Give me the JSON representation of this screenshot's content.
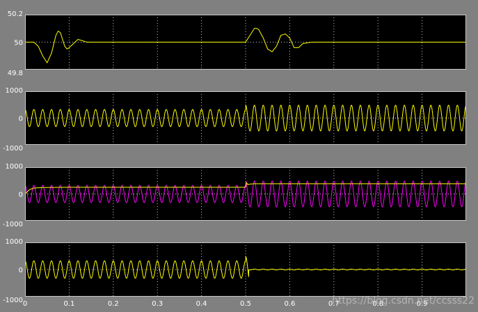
{
  "colors": {
    "figure_bg": "#808080",
    "plot_bg": "#000000",
    "grid": "#ffffff",
    "tick_text": "#ffffff",
    "yellow": "#ffff00",
    "magenta": "#ff00ff"
  },
  "watermark": "https://blog.csdn.net/ccsss22",
  "chart_data": [
    {
      "type": "line",
      "title": "",
      "xlabel": "",
      "ylabel": "",
      "xlim": [
        0,
        1
      ],
      "ylim": [
        49.8,
        50.2
      ],
      "xticks": [
        0,
        0.1,
        0.2,
        0.3,
        0.4,
        0.5,
        0.6,
        0.7,
        0.8,
        0.9
      ],
      "yticks": [
        {
          "value": 49.8,
          "label": "49.8"
        },
        {
          "value": 50,
          "label": "50"
        },
        {
          "value": 50.2,
          "label": "50.2"
        }
      ],
      "grid": true,
      "series": [
        {
          "color": "#ffff00",
          "kind": "points",
          "x": [
            0,
            0.01,
            0.02,
            0.03,
            0.04,
            0.05,
            0.06,
            0.07,
            0.075,
            0.08,
            0.09,
            0.095,
            0.1,
            0.11,
            0.12,
            0.13,
            0.14,
            0.15,
            0.2,
            0.3,
            0.4,
            0.5,
            0.51,
            0.52,
            0.525,
            0.53,
            0.54,
            0.55,
            0.56,
            0.57,
            0.58,
            0.59,
            0.6,
            0.61,
            0.62,
            0.63,
            0.65,
            0.7,
            0.8,
            0.9,
            1.0
          ],
          "y": [
            50,
            50,
            50,
            49.97,
            49.9,
            49.85,
            49.92,
            50.05,
            50.08,
            50.07,
            49.97,
            49.95,
            49.96,
            49.99,
            50.02,
            50.01,
            50,
            50,
            50,
            50,
            50,
            50,
            50.05,
            50.1,
            50.1,
            50.09,
            50.03,
            49.95,
            49.93,
            49.97,
            50.05,
            50.06,
            50.03,
            49.96,
            49.96,
            49.99,
            50,
            50,
            50,
            50,
            50
          ]
        }
      ]
    },
    {
      "type": "line",
      "title": "",
      "xlabel": "",
      "ylabel": "",
      "xlim": [
        0,
        1
      ],
      "ylim": [
        -1000,
        1000
      ],
      "xticks": [
        0,
        0.1,
        0.2,
        0.3,
        0.4,
        0.5,
        0.6,
        0.7,
        0.8,
        0.9
      ],
      "yticks": [
        {
          "value": -1000,
          "label": "-1000"
        },
        {
          "value": 0,
          "label": "0"
        },
        {
          "value": 1000,
          "label": "1000"
        }
      ],
      "grid": true,
      "series": [
        {
          "color": "#ffff00",
          "kind": "sine",
          "frequency_hz": 50,
          "segments": [
            {
              "t0": 0,
              "t1": 0.5,
              "amplitude": 320,
              "phase_deg": 90
            },
            {
              "t0": 0.5,
              "t1": 1.0,
              "amplitude": 480,
              "phase_deg": 90
            }
          ]
        }
      ]
    },
    {
      "type": "line",
      "title": "",
      "xlabel": "",
      "ylabel": "",
      "xlim": [
        0,
        1
      ],
      "ylim": [
        -1000,
        1000
      ],
      "xticks": [
        0,
        0.1,
        0.2,
        0.3,
        0.4,
        0.5,
        0.6,
        0.7,
        0.8,
        0.9
      ],
      "yticks": [
        {
          "value": -1000,
          "label": "-1000"
        },
        {
          "value": 0,
          "label": "0"
        },
        {
          "value": 1000,
          "label": "1000"
        }
      ],
      "grid": true,
      "series": [
        {
          "color": "#ff00ff",
          "kind": "sine",
          "frequency_hz": 50,
          "segments": [
            {
              "t0": 0,
              "t1": 0.5,
              "amplitude": 320,
              "phase_deg": 90
            },
            {
              "t0": 0.5,
              "t1": 1.0,
              "amplitude": 480,
              "phase_deg": 90
            }
          ]
        },
        {
          "color": "#ffff00",
          "kind": "points",
          "x": [
            0,
            0.005,
            0.01,
            0.02,
            0.04,
            0.1,
            0.3,
            0.49,
            0.5,
            0.502,
            0.505,
            0.51,
            0.52,
            0.6,
            0.8,
            1.0
          ],
          "y": [
            0,
            80,
            160,
            220,
            240,
            250,
            250,
            250,
            250,
            420,
            350,
            370,
            380,
            380,
            380,
            380
          ]
        }
      ]
    },
    {
      "type": "line",
      "title": "",
      "xlabel": "",
      "ylabel": "",
      "xlim": [
        0,
        1
      ],
      "ylim": [
        -1000,
        1000
      ],
      "xticks": [
        0,
        0.1,
        0.2,
        0.3,
        0.4,
        0.5,
        0.6,
        0.7,
        0.8,
        0.9
      ],
      "xtick_labels": [
        "0",
        "0.1",
        "0.2",
        "0.3",
        "0.4",
        "0.5",
        "0.6",
        "0.7",
        "0.8",
        "0.9"
      ],
      "yticks": [
        {
          "value": -1000,
          "label": "-1000"
        },
        {
          "value": 0,
          "label": "0"
        },
        {
          "value": 1000,
          "label": "1000"
        }
      ],
      "grid": true,
      "series": [
        {
          "color": "#ffff00",
          "kind": "sine",
          "frequency_hz": 50,
          "segments": [
            {
              "t0": 0,
              "t1": 0.5,
              "amplitude": 320,
              "phase_deg": 90
            },
            {
              "t0": 0.5,
              "t1": 0.507,
              "amplitude": 480,
              "phase_deg": 90
            },
            {
              "t0": 0.507,
              "t1": 1.0,
              "amplitude": 15,
              "phase_deg": 90
            }
          ]
        }
      ]
    }
  ]
}
